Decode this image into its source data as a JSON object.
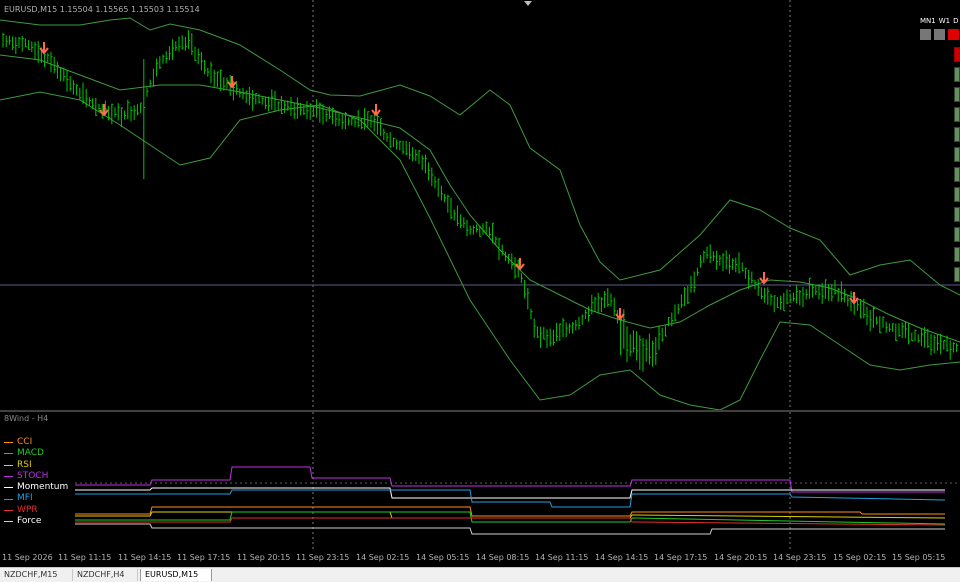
{
  "chart": {
    "symbol_title": "EURUSD,M15  1.15504  1.15565  1.15503  1.15514",
    "colors": {
      "background": "#000000",
      "bars": "#00c800",
      "bands": "#3f9a3f",
      "grid": "#7a7a7a",
      "signal_arrow": "#ff6a4a",
      "price_line": "#5a5a8a"
    }
  },
  "subwindow": {
    "title": "8Wind - H4",
    "indicators": [
      {
        "label": "CCI",
        "color": "#ff8c1a"
      },
      {
        "label": "MACD",
        "color": "#22cc22"
      },
      {
        "label": "RSI",
        "color": "#e0d000"
      },
      {
        "label": "STOCH",
        "color": "#c030e0"
      },
      {
        "label": "Momentum",
        "color": "#ffffff"
      },
      {
        "label": "MFI",
        "color": "#20a0e0"
      },
      {
        "label": "WPR",
        "color": "#e03030"
      },
      {
        "label": "Force",
        "color": "#d0d0d0"
      }
    ]
  },
  "timeframes": {
    "labels": [
      "MN1",
      "W1",
      "D"
    ],
    "boxes": [
      {
        "color": "#777777"
      },
      {
        "color": "#777777"
      },
      {
        "color": "#e00000"
      }
    ]
  },
  "time_axis": [
    "11 Sep 2026",
    "11 Sep 11:15",
    "11 Sep 14:15",
    "11 Sep 17:15",
    "11 Sep 20:15",
    "11 Sep 23:15",
    "14 Sep 02:15",
    "14 Sep 05:15",
    "14 Sep 08:15",
    "14 Sep 11:15",
    "14 Sep 14:15",
    "14 Sep 17:15",
    "14 Sep 20:15",
    "14 Sep 23:15",
    "15 Sep 02:15",
    "15 Sep 05:15"
  ],
  "tabs": [
    {
      "label": "NZDCHF,M15",
      "active": false
    },
    {
      "label": "NZDCHF,H4",
      "active": false
    },
    {
      "label": "EURUSD,M15",
      "active": true
    }
  ]
}
